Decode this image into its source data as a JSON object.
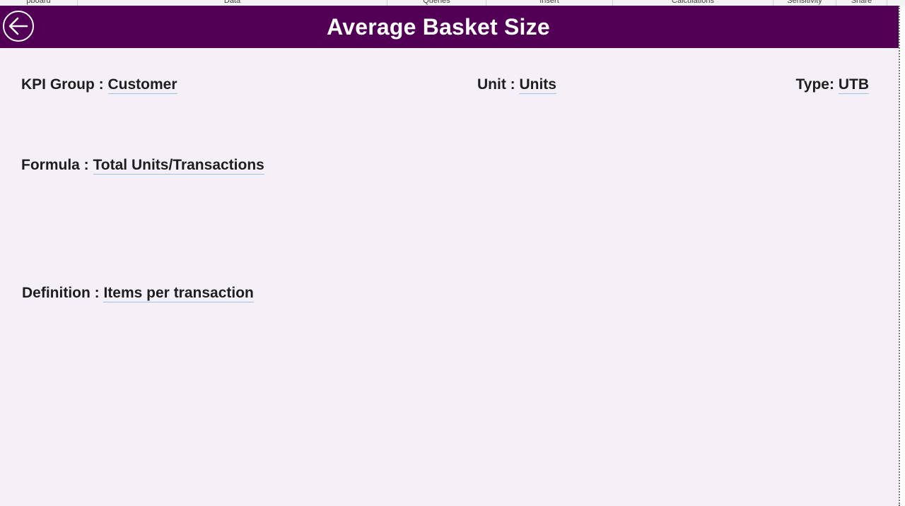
{
  "ribbon": {
    "groups": [
      {
        "label": "pboard"
      },
      {
        "label": "Data"
      },
      {
        "label": "Queries"
      },
      {
        "label": "Insert"
      },
      {
        "label": "Calculations"
      },
      {
        "label": "Sensitivity"
      },
      {
        "label": "Share"
      }
    ]
  },
  "header": {
    "title": "Average Basket Size",
    "back_icon": "arrow-left-circle-icon",
    "background_color": "#520055"
  },
  "fields": {
    "kpi_group": {
      "label": "KPI Group : ",
      "value": "Customer"
    },
    "unit": {
      "label": "Unit : ",
      "value": "Units"
    },
    "type": {
      "label": "Type: ",
      "value": "UTB"
    },
    "formula": {
      "label": "Formula : ",
      "value": "Total Units/Transactions"
    },
    "definition": {
      "label": "Definition : ",
      "value": "Items per transaction"
    }
  },
  "colors": {
    "canvas": "#f5f0f7",
    "text": "#1e1e1e",
    "underline": "#9fc3e6"
  }
}
